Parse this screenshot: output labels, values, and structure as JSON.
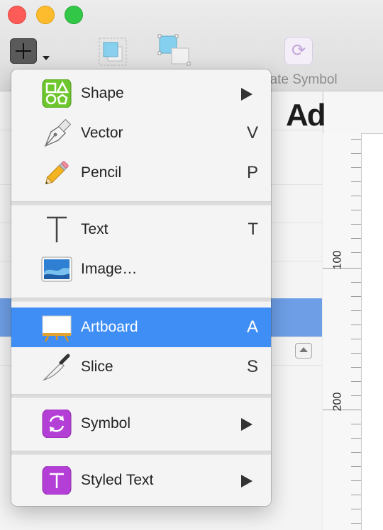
{
  "window": {
    "controls": [
      "close",
      "minimize",
      "zoom"
    ]
  },
  "toolbar": {
    "insert_icon": "plus-icon",
    "create_symbol_label": "eate Symbol",
    "create_symbol_icon": "symbol-sync-icon"
  },
  "canvas": {
    "text_fragment": "Ad",
    "ruler_labels": [
      "100",
      "200"
    ]
  },
  "menu": {
    "items": [
      {
        "label": "Shape",
        "shortcut": "",
        "submenu": true,
        "icon": "shape-icon"
      },
      {
        "label": "Vector",
        "shortcut": "V",
        "submenu": false,
        "icon": "vector-pen-icon"
      },
      {
        "label": "Pencil",
        "shortcut": "P",
        "submenu": false,
        "icon": "pencil-icon"
      },
      {
        "label": "Text",
        "shortcut": "T",
        "submenu": false,
        "icon": "text-icon"
      },
      {
        "label": "Image…",
        "shortcut": "",
        "submenu": false,
        "icon": "image-icon"
      },
      {
        "label": "Artboard",
        "shortcut": "A",
        "submenu": false,
        "icon": "artboard-icon",
        "highlighted": true
      },
      {
        "label": "Slice",
        "shortcut": "S",
        "submenu": false,
        "icon": "slice-knife-icon"
      },
      {
        "label": "Symbol",
        "shortcut": "",
        "submenu": true,
        "icon": "symbol-icon"
      },
      {
        "label": "Styled Text",
        "shortcut": "",
        "submenu": true,
        "icon": "styled-text-icon"
      }
    ]
  },
  "colors": {
    "highlight": "#3f8ef6",
    "selected_row": "#6e9fe6",
    "shape_green": "#6cc62c",
    "symbol_purple": "#b43fd6"
  }
}
